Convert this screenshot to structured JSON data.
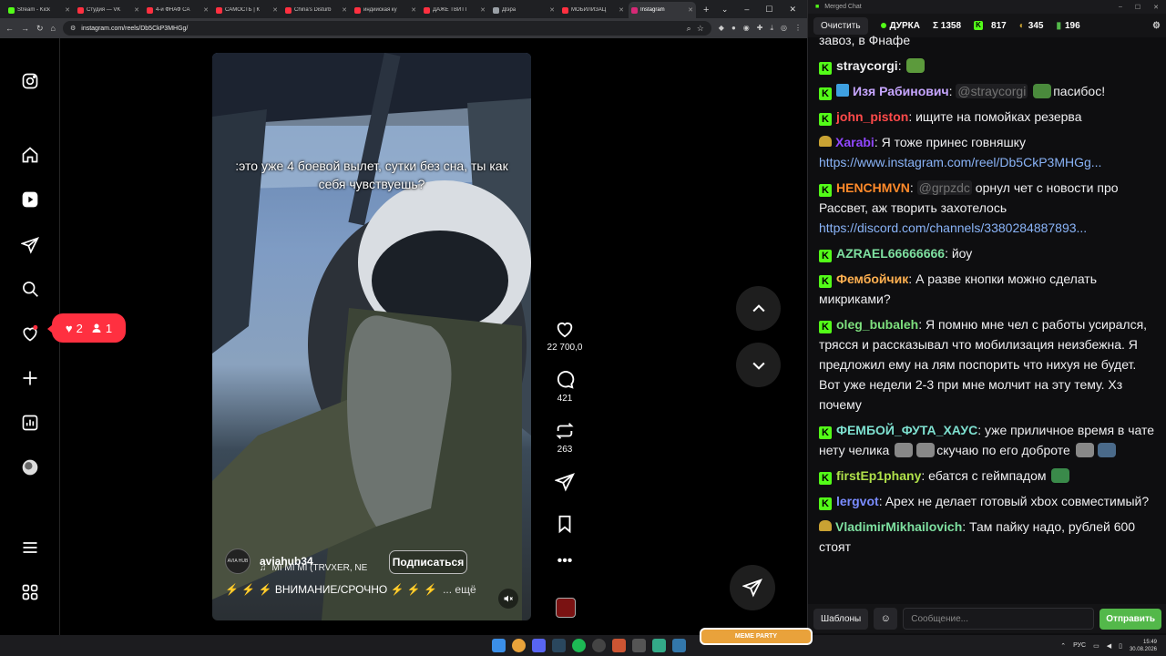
{
  "browser": {
    "tabs": [
      {
        "title": "Stream - Kick",
        "color": "#53fc18"
      },
      {
        "title": "Студия — VK",
        "color": "#ff3040"
      },
      {
        "title": "4-й ФНАФ СА",
        "color": "#ff3040"
      },
      {
        "title": "САМОСТЬ | К",
        "color": "#ff3040"
      },
      {
        "title": "China's Disturb",
        "color": "#ff3040"
      },
      {
        "title": "индийская ку",
        "color": "#ff3040"
      },
      {
        "title": "ДАЖЕ ТВИТТ",
        "color": "#ff3040"
      },
      {
        "title": "Дlэра",
        "color": "#9aa0a6"
      },
      {
        "title": "МОБИЛИЗАЦ",
        "color": "#ff3040"
      },
      {
        "title": "Instagram",
        "color": "#d62976"
      }
    ],
    "url": "instagram.com/reels/Db5CkP3MHGg/"
  },
  "instagram": {
    "overlay_caption": ":это уже 4 боевой вылет, сутки без сна, ты как себя чувствуешь?",
    "notifications": {
      "likes": "2",
      "follows": "1"
    },
    "author": "aviahub34",
    "avatar_text": "AVIA HUB",
    "music": "MI MI MI (TRVXER, NE",
    "follow_label": "Подписаться",
    "description": "⚡ ⚡ ⚡ ВНИМАНИЕ/СРОЧНО ⚡ ⚡ ⚡",
    "more_label": "... ещё",
    "likes": "22 700,0",
    "comments": "421",
    "reposts": "263"
  },
  "chat": {
    "window_title": "Merged Chat",
    "clear_label": "Очистить",
    "channel": "ДУРКА",
    "total": "Σ 1358",
    "kick_count": "817",
    "other_count": "345",
    "money_count": "196",
    "messages": [
      {
        "user": "",
        "color": "#efeff1",
        "badge": "none",
        "parts": [
          {
            "t": "text",
            "v": "завоз, в Фнафе"
          }
        ]
      },
      {
        "user": "straycorgi",
        "color": "#efeff1",
        "badge": "k",
        "parts": [
          {
            "t": "emote",
            "v": "#5c9a3c"
          }
        ]
      },
      {
        "user": "Изя Рабинович",
        "color": "#c7a6ff",
        "badge": "k-star",
        "parts": [
          {
            "t": "mention",
            "v": "@straycorgi"
          },
          {
            "t": "emote",
            "v": "#4a8a3c"
          },
          {
            "t": "text",
            "v": "пасибос!"
          }
        ]
      },
      {
        "user": "john_piston",
        "color": "#ff4a4a",
        "badge": "k",
        "parts": [
          {
            "t": "text",
            "v": "ищите на помойках резерва"
          }
        ]
      },
      {
        "user": "Xarabi",
        "color": "#9147ff",
        "badge": "other",
        "parts": [
          {
            "t": "text",
            "v": "Я тоже принес говняшку "
          },
          {
            "t": "link",
            "v": "https://www.instagram.com/reel/Db5CkP3MHGg..."
          }
        ]
      },
      {
        "user": "HENCHMVN",
        "color": "#ff8a2a",
        "badge": "k",
        "parts": [
          {
            "t": "mention",
            "v": "@grpzdc"
          },
          {
            "t": "text",
            "v": "орнул чет с новости про Рассвет, аж творить захотелось "
          },
          {
            "t": "link",
            "v": "https://discord.com/channels/3380284887893..."
          }
        ]
      },
      {
        "user": "AZRAEL66666666",
        "color": "#7ee0a0",
        "badge": "k",
        "parts": [
          {
            "t": "text",
            "v": "йоу"
          }
        ]
      },
      {
        "user": "Фембойчик",
        "color": "#ffb050",
        "badge": "k",
        "parts": [
          {
            "t": "text",
            "v": "А разве кнопки можно сделать микриками?"
          }
        ]
      },
      {
        "user": "oleg_bubaleh",
        "color": "#7ee07e",
        "badge": "k",
        "parts": [
          {
            "t": "text",
            "v": "Я помню мне чел с работы усирался, трясся и рассказывал что мобилизация неизбежна. Я предложил ему на лям поспорить что нихуя не будет. Вот уже недели 2-3 при мне молчит на эту тему. Хз почему"
          }
        ]
      },
      {
        "user": "ФЕМБОЙ_ФУТА_ХАУС",
        "color": "#7ee0d0",
        "badge": "k",
        "parts": [
          {
            "t": "text",
            "v": "уже приличное время в чате нету челика"
          },
          {
            "t": "emote",
            "v": "#888"
          },
          {
            "t": "emote",
            "v": "#888"
          },
          {
            "t": "text",
            "v": "скучаю по его доброте"
          },
          {
            "t": "emote",
            "v": "#888"
          },
          {
            "t": "emote",
            "v": "#4a6a8a"
          }
        ]
      },
      {
        "user": "firstEp1phany",
        "color": "#b0e04a",
        "badge": "k",
        "parts": [
          {
            "t": "text",
            "v": "ебатся с геймпадом"
          },
          {
            "t": "emote",
            "v": "#3a8a4a"
          }
        ]
      },
      {
        "user": "lergvot",
        "color": "#7a8cff",
        "badge": "k",
        "parts": [
          {
            "t": "text",
            "v": "Apex не делает готовый xbox совместимый?"
          }
        ]
      },
      {
        "user": "VladimirMikhailovich",
        "color": "#7ee0a0",
        "badge": "other",
        "parts": [
          {
            "t": "text",
            "v": "Там пайку надо, рублей 600 стоят"
          }
        ]
      }
    ],
    "templates_label": "Шаблоны",
    "input_placeholder": "Сообщение...",
    "send_label": "Отправить"
  },
  "taskbar": {
    "meme_banner": "MEME PARTY",
    "lang": "РУС",
    "time": "15:49",
    "date": "30.08.2026"
  }
}
